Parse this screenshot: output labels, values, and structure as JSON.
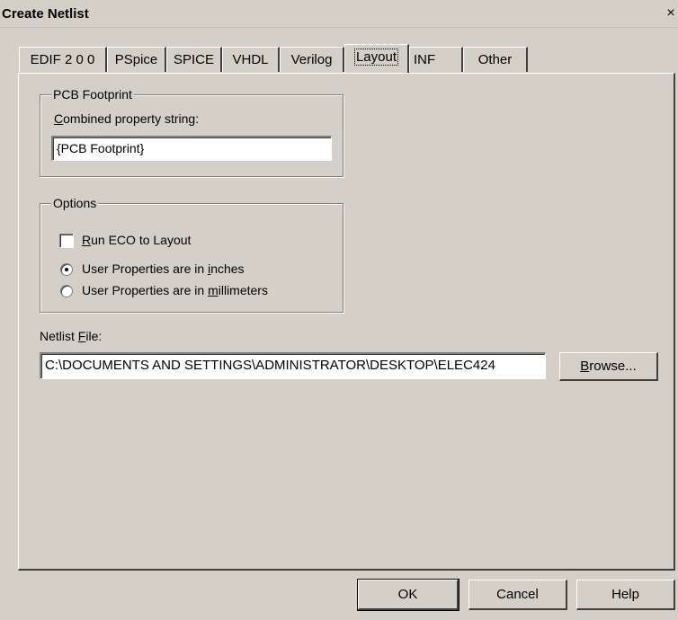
{
  "window": {
    "title": "Create Netlist",
    "close_glyph": "×"
  },
  "tabs": [
    {
      "label": "EDIF 2 0 0",
      "active": false
    },
    {
      "label": "PSpice",
      "active": false
    },
    {
      "label": "SPICE",
      "active": false
    },
    {
      "label": "VHDL",
      "active": false
    },
    {
      "label": "Verilog",
      "active": false
    },
    {
      "label": "Layout",
      "active": true
    },
    {
      "label": "INF",
      "active": false
    },
    {
      "label": "Other",
      "active": false
    }
  ],
  "pcb_footprint": {
    "legend": "PCB Footprint",
    "combined_label_mnemonic": "C",
    "combined_label_rest": "ombined property string:",
    "value": "{PCB Footprint}"
  },
  "options": {
    "legend": "Options",
    "run_eco_mnemonic": "R",
    "run_eco_rest": "un ECO to Layout",
    "run_eco_checked": false,
    "radio_inches_pre": "User Properties are in ",
    "radio_inches_mnemonic": "i",
    "radio_inches_post": "nches",
    "radio_inches_selected": true,
    "radio_mm_pre": "User Properties are in ",
    "radio_mm_mnemonic": "m",
    "radio_mm_post": "illimeters",
    "radio_mm_selected": false
  },
  "netlist_file": {
    "label_pre": "Netlist ",
    "label_mnemonic": "F",
    "label_post": "ile:",
    "value": "C:\\DOCUMENTS AND SETTINGS\\ADMINISTRATOR\\DESKTOP\\ELEC424",
    "browse_mnemonic": "B",
    "browse_rest": "rowse..."
  },
  "buttons": {
    "ok": "OK",
    "cancel": "Cancel",
    "help": "Help"
  }
}
